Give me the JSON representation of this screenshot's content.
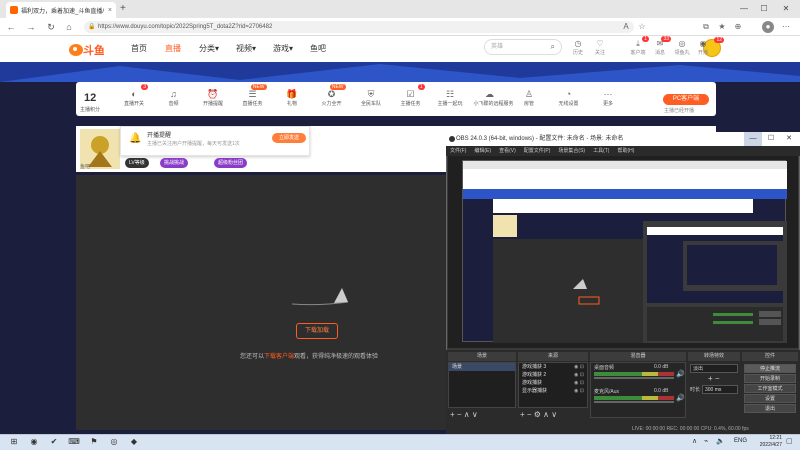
{
  "browser": {
    "tab_title": "福利双力，乘着加速_斗鱼直播/",
    "tab_close": "×",
    "new_tab": "+",
    "url": "https://www.douyu.com/topic/2022Spring5T_dota2Z?rid=2706482",
    "win_min": "—",
    "win_max": "☐",
    "win_close": "✕"
  },
  "douyu": {
    "logo_text": "斗鱼",
    "nav": [
      "首页",
      "直播",
      "分类▾",
      "视频▾",
      "游戏▾",
      "鱼吧"
    ],
    "active_nav": "直播",
    "search_placeholder": "英雄",
    "header_icons": [
      {
        "label": "历史",
        "icon": "clock-icon",
        "glyph": "◷",
        "badge": ""
      },
      {
        "label": "关注",
        "icon": "heart-icon",
        "glyph": "♡",
        "badge": ""
      },
      {
        "label": "客户端",
        "icon": "download-icon",
        "glyph": "⤓",
        "badge": "1"
      },
      {
        "label": "消息",
        "icon": "bell-icon",
        "glyph": "✉",
        "badge": "33"
      },
      {
        "label": "领鱼丸",
        "icon": "coin-icon",
        "glyph": "◎",
        "badge": ""
      },
      {
        "label": "开播",
        "icon": "live-icon",
        "glyph": "◉",
        "badge": ""
      }
    ],
    "avatar_badge": "12"
  },
  "toolbar": {
    "score": "12",
    "score_label": "主播积分",
    "items": [
      {
        "label": "直播开关",
        "glyph": "◐",
        "icon": "switch-icon",
        "badge": "3"
      },
      {
        "label": "音频",
        "glyph": "♫",
        "icon": "audio-icon",
        "badge": ""
      },
      {
        "label": "开播提醒",
        "glyph": "⏰",
        "icon": "alarm-icon",
        "badge": ""
      },
      {
        "label": "直播任务",
        "glyph": "☰",
        "icon": "task-icon",
        "badge": "NEW"
      },
      {
        "label": "礼物",
        "glyph": "🎁",
        "icon": "gift-icon",
        "badge": ""
      },
      {
        "label": "火力全开",
        "glyph": "✪",
        "icon": "fire-icon",
        "badge": "NEW"
      },
      {
        "label": "全民车队",
        "glyph": "⛨",
        "icon": "shield-icon",
        "badge": ""
      },
      {
        "label": "主播任务",
        "glyph": "☑",
        "icon": "checklist-icon",
        "badge": "1"
      },
      {
        "label": "主播一起玩",
        "glyph": "☷",
        "icon": "play-together-icon",
        "badge": ""
      },
      {
        "label": "小飞碟的远程服务",
        "glyph": "☁",
        "icon": "cloud-icon",
        "badge": ""
      },
      {
        "label": "房管",
        "glyph": "♙",
        "icon": "admin-icon",
        "badge": ""
      },
      {
        "label": "无线设置",
        "glyph": "◔",
        "icon": "gauge-icon",
        "badge": ""
      },
      {
        "label": "更多",
        "glyph": "⋯",
        "icon": "more-icon",
        "badge": ""
      }
    ],
    "pc_button": "PC客户端",
    "pc_label": "主播已经开播"
  },
  "streamer": {
    "popup_title": "开播提醒",
    "popup_sub": "主播已关注用户开播提醒，每天可发送1次",
    "popup_button": "立即发送",
    "name": "鱼吧",
    "pills": [
      {
        "text": "LV等级",
        "color": "#333333"
      },
      {
        "text": "挑战挑战",
        "color": "#8a3cc9"
      },
      {
        "text": "超级粉丝团",
        "color": "#8a3cc9"
      }
    ]
  },
  "video": {
    "download_button": "下载加载",
    "tip_prefix": "您还可以",
    "tip_link": "下载客户端",
    "tip_suffix": "观看，获得纯净极速的观看体验"
  },
  "obs": {
    "title": "OBS 24.0.3 (64-bit, windows) - 配置文件: 未命名 - 场景: 未命名",
    "menu": [
      "文件(F)",
      "编辑(E)",
      "查看(V)",
      "配置文件(P)",
      "场景集合(S)",
      "工具(T)",
      "帮助(H)"
    ],
    "docks": {
      "scenes": "场景",
      "sources": "来源",
      "mixer": "混音器",
      "transitions": "转场特效",
      "controls": "控件"
    },
    "scene_items": [
      "场景"
    ],
    "source_items": [
      "游戏捕获 3",
      "游戏捕获 2",
      "游戏捕获",
      "显示器捕获"
    ],
    "mixer_items": [
      {
        "name": "桌面音频",
        "level": "0.0 dB"
      },
      {
        "name": "麦克风/Aux",
        "level": "0.0 dB"
      }
    ],
    "transition_value": "淡出",
    "duration_label": "时长",
    "duration_value": "300 ms",
    "controls": [
      "停止推流",
      "开始录制",
      "工作室模式",
      "设置",
      "退出"
    ],
    "status": "LIVE: 00:00:00  REC: 00:00:00  CPU: 0.4%, 60.00 fps"
  },
  "taskbar": {
    "apps": [
      "⊞",
      "◉",
      "✔",
      "⌨",
      "⚑",
      "◎",
      "◆"
    ],
    "lang": "ENG",
    "time": "12:21",
    "date": "2022/4/27"
  }
}
